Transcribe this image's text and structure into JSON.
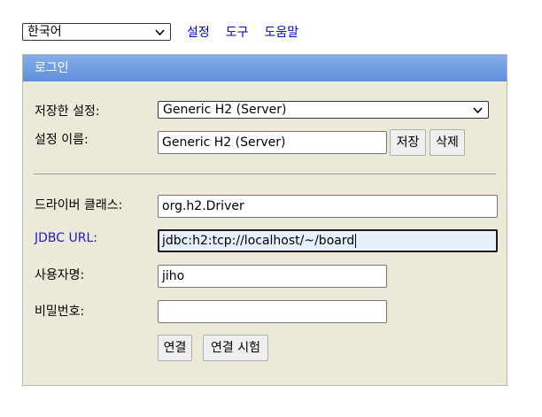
{
  "top": {
    "language": "한국어",
    "links": [
      "설정",
      "도구",
      "도움말"
    ]
  },
  "login": {
    "header": "로그인",
    "saved_settings_label": "저장한 설정:",
    "saved_settings_value": "Generic H2 (Server)",
    "setting_name_label": "설정 이름:",
    "setting_name_value": "Generic H2 (Server)",
    "save_button": "저장",
    "delete_button": "삭제",
    "driver_class_label": "드라이버 클래스:",
    "driver_class_value": "org.h2.Driver",
    "jdbc_url_label": "JDBC URL:",
    "jdbc_url_value": "jdbc:h2:tcp://localhost/~/board",
    "username_label": "사용자명:",
    "username_value": "jiho",
    "password_label": "비밀번호:",
    "password_value": "",
    "connect_button": "연결",
    "test_connection_button": "연결 시험"
  },
  "icons": {
    "dropdown": "chevron-down-icon"
  }
}
